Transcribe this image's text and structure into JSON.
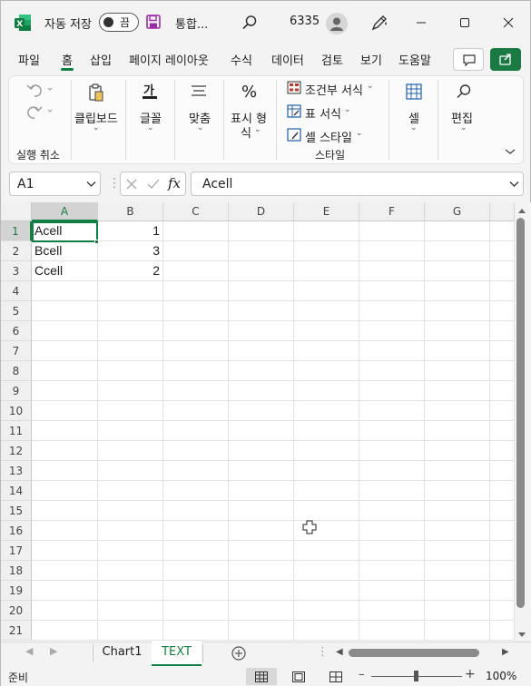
{
  "titlebar": {
    "autosave_label": "자동 저장",
    "autosave_state": "끔",
    "doc_title": "통합...",
    "user_text": "6335"
  },
  "tabs": [
    "파일",
    "홈",
    "삽입",
    "페이지 레이아웃",
    "수식",
    "데이터",
    "검토",
    "보기",
    "도움말"
  ],
  "ribbon": {
    "undo_group_label": "실행 취소",
    "clipboard": "클립보드",
    "font": "글꼴",
    "align": "맞춤",
    "number_line1": "표시 형",
    "number_line2": "식",
    "cond_format": "조건부 서식",
    "table_format": "표 서식",
    "cell_styles": "셀 스타일",
    "styles_group_label": "스타일",
    "cells": "셀",
    "editing": "편집"
  },
  "formula_bar": {
    "name_box": "A1",
    "fx_label": "fx",
    "formula_value": "Acell"
  },
  "sheet": {
    "columns": [
      "A",
      "B",
      "C",
      "D",
      "E",
      "F",
      "G"
    ],
    "rows": [
      "1",
      "2",
      "3",
      "4",
      "5",
      "6",
      "7",
      "8",
      "9",
      "10",
      "11",
      "12",
      "13",
      "14",
      "15",
      "16",
      "17",
      "18",
      "19",
      "20",
      "21"
    ],
    "cells": {
      "A1": "Acell",
      "B1": "1",
      "A2": "Bcell",
      "B2": "3",
      "A3": "Ccell",
      "B3": "2"
    }
  },
  "sheet_tabs": [
    {
      "name": "Chart1",
      "active": false
    },
    {
      "name": "TEXT",
      "active": true
    }
  ],
  "status": {
    "ready_text": "준비",
    "zoom": "100%"
  },
  "colors": {
    "accent_green": "#137e43",
    "excel_brand": "#1d6f42"
  }
}
